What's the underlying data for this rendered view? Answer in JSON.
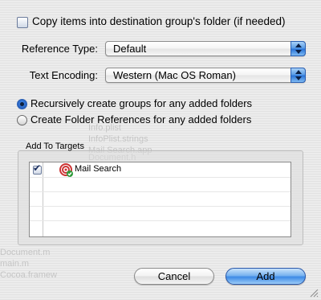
{
  "options": {
    "copy_items_label": "Copy items into destination group's folder (if needed)",
    "copy_items_checked": false
  },
  "reference_type": {
    "label": "Reference Type:",
    "value": "Default"
  },
  "text_encoding": {
    "label": "Text Encoding:",
    "value": "Western (Mac OS Roman)"
  },
  "folder_mode": {
    "recursive_label": "Recursively create groups for any added folders",
    "folder_refs_label": "Create Folder References for any added folders",
    "selected": "recursive"
  },
  "targets": {
    "title": "Add To Targets",
    "items": [
      {
        "name": "Mail Search",
        "checked": true,
        "icon": "application-target-icon"
      }
    ]
  },
  "buttons": {
    "cancel": "Cancel",
    "add": "Add"
  },
  "background_ghost": [
    "Document.h",
    "Info.plist",
    "InfoPlist.strings",
    "Mail Search.app",
    "Document.m",
    "main.m",
    "Cocoa.framew"
  ],
  "colors": {
    "accent": "#3d8ae6",
    "window_bg": "#e6e6e6"
  }
}
